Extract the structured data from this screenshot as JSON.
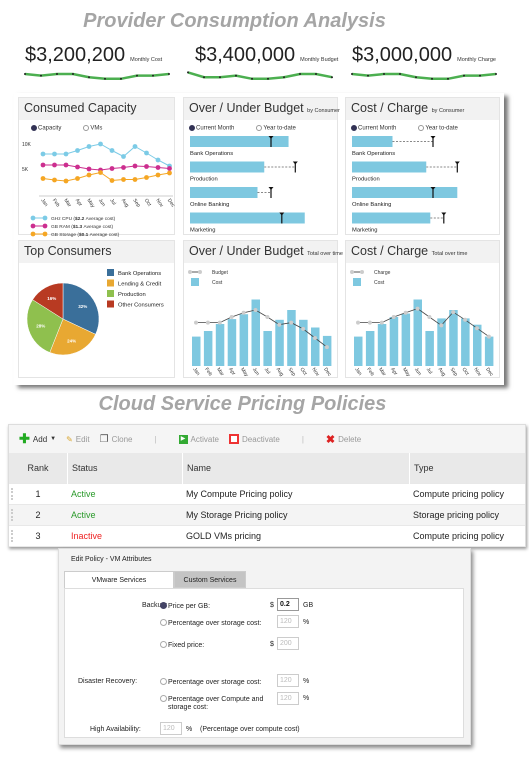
{
  "title": "Provider Consumption Analysis",
  "kpis": [
    {
      "value": "$3,200,200",
      "label": "Monthly Cost",
      "spark": [
        5,
        4,
        5,
        5,
        3,
        2,
        2,
        4,
        4,
        5
      ]
    },
    {
      "value": "$3,400,000",
      "label": "Monthly Budget",
      "spark": [
        6,
        3,
        3,
        4,
        2,
        2,
        3,
        5,
        5,
        3
      ]
    },
    {
      "value": "$3,000,000",
      "label": "Monthly Charge",
      "spark": [
        5,
        4,
        5,
        5,
        3,
        2,
        2,
        4,
        4,
        5
      ]
    }
  ],
  "colors": {
    "spark": "#4caf50",
    "bar": "#7ec8e0",
    "cpu": "#7ccbe6",
    "ram": "#cc2e8f",
    "storage": "#f5a623"
  },
  "months": [
    "Jan",
    "Feb",
    "Mar",
    "Apr",
    "May",
    "Jun",
    "Jul",
    "Aug",
    "Sep",
    "Oct",
    "Nov",
    "Dec"
  ],
  "capacity": {
    "title": "Consumed Capacity",
    "radios": [
      "Capacity",
      "VMs"
    ],
    "selected": "Capacity",
    "chart_data": {
      "type": "line",
      "yticks": [
        "10K",
        "5K"
      ],
      "series": [
        {
          "key": "cpu",
          "values": [
            8,
            8,
            8,
            8.7,
            9.5,
            10,
            8.7,
            7.5,
            9.5,
            8.2,
            6.8,
            5.6
          ],
          "legend": "GHz CPU",
          "note": "$2.2",
          "suffix": "Average cost)"
        },
        {
          "key": "ram",
          "values": [
            5.8,
            5.8,
            5.8,
            5.4,
            5,
            4.8,
            5.1,
            5.3,
            5.6,
            5.5,
            5.3,
            5.1
          ],
          "legend": "GB RAM",
          "note": "$1.3",
          "suffix": "Average cost)"
        },
        {
          "key": "storage",
          "values": [
            3.1,
            2.8,
            2.6,
            3.1,
            3.8,
            4.3,
            2.7,
            2.9,
            2.9,
            3.3,
            3.8,
            4.2
          ],
          "legend": "GB Storage",
          "note": "$0.1",
          "suffix": "Average cost)"
        }
      ]
    }
  },
  "budget_by": {
    "title": "Over / Under Budget",
    "sub": "by Consumer",
    "radios": [
      "Current Month",
      "Year to-date"
    ],
    "items": [
      {
        "label": "Bank Operations",
        "value": 0.73,
        "target": 0.6
      },
      {
        "label": "Production",
        "value": 0.55,
        "target": 0.78
      },
      {
        "label": "Online Banking",
        "value": 0.5,
        "target": 0.6
      },
      {
        "label": "Marketing",
        "value": 0.85,
        "target": 0.68
      }
    ]
  },
  "charge_by": {
    "title": "Cost / Charge",
    "sub": "by Consumer",
    "radios": [
      "Current Month",
      "Year to-date"
    ],
    "items": [
      {
        "label": "Bank Operations",
        "value": 0.3,
        "target": 0.6
      },
      {
        "label": "Production",
        "value": 0.55,
        "target": 0.78
      },
      {
        "label": "Online Banking",
        "value": 0.78,
        "target": 0.6
      },
      {
        "label": "Marketing",
        "value": 0.58,
        "target": 0.68
      }
    ]
  },
  "top": {
    "title": "Top Consumers",
    "chart_data": {
      "type": "pie",
      "slices": [
        {
          "name": "Bank Operations",
          "value": 32,
          "label": "32%",
          "color": "#3a6f9a"
        },
        {
          "name": "Lending & Credit",
          "value": 24,
          "label": "24%",
          "color": "#e8a832"
        },
        {
          "name": "Production",
          "value": 28,
          "label": "28%",
          "color": "#8fc04e"
        },
        {
          "name": "Other Consumers",
          "value": 16,
          "label": "16%",
          "color": "#b83a22"
        }
      ]
    }
  },
  "budget_time": {
    "title": "Over / Under Budget",
    "sub": "Total over time",
    "legend": [
      "Budget",
      "Cost"
    ],
    "chart_data": {
      "type": "bar",
      "cost": [
        4.2,
        5,
        6,
        6.7,
        7.4,
        9.5,
        5,
        6.6,
        8,
        6.6,
        5.5,
        4.3
      ],
      "line": [
        6.2,
        6.2,
        6.2,
        7,
        7.6,
        8,
        7,
        5.9,
        6.2,
        5.3,
        4,
        2.7
      ]
    }
  },
  "charge_time": {
    "title": "Cost / Charge",
    "sub": "Total over time",
    "legend": [
      "Charge",
      "Cost"
    ],
    "chart_data": {
      "type": "bar",
      "cost": [
        4.2,
        5,
        6,
        7,
        7.5,
        9.5,
        5,
        6.8,
        8,
        6.8,
        5.9,
        4.2
      ],
      "line": [
        6.2,
        6.2,
        6.2,
        7,
        7.6,
        8.2,
        7,
        5.8,
        7.7,
        6.6,
        5.4,
        4.2
      ]
    }
  },
  "section2": "Cloud Service Pricing Policies",
  "toolbar": {
    "add": "Add",
    "edit": "Edit",
    "clone": "Clone",
    "activate": "Activate",
    "deactivate": "Deactivate",
    "delete": "Delete"
  },
  "table": {
    "headers": [
      "Rank",
      "Status",
      "Name",
      "Type"
    ],
    "rows": [
      {
        "rank": "1",
        "status": "Active",
        "name": "My Compute Pricing policy",
        "type": "Compute pricing policy"
      },
      {
        "rank": "2",
        "status": "Active",
        "name": "My Storage Pricing policy",
        "type": "Storage pricing policy"
      },
      {
        "rank": "3",
        "status": "Inactive",
        "name": "GOLD VMs pricing",
        "type": "Compute pricing policy"
      }
    ]
  },
  "dialog": {
    "title": "Edit Policy - VM Attributes",
    "tabs": [
      "VMware Services",
      "Custom Services"
    ],
    "backup": "Backup:",
    "price_gb": "Price per GB:",
    "price_gb_val": "0.2",
    "gb": "GB",
    "pct_storage": "Percentage over storage cost:",
    "pct_val": "120",
    "pct": "%",
    "fixed": "Fixed price:",
    "fixed_val": "200",
    "dollar": "$",
    "dr": "Disaster Recovery:",
    "pct_cs": "Percentage over Compute and",
    "pct_cs2": "storage cost:",
    "ha": "High Availability:",
    "ha_note": "(Percentage over compute cost)"
  }
}
